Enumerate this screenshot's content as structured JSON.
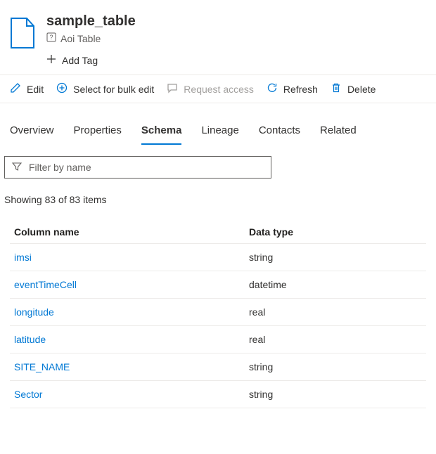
{
  "header": {
    "title": "sample_table",
    "subtitle": "Aoi Table",
    "add_tag_label": "Add Tag"
  },
  "toolbar": {
    "edit": "Edit",
    "bulk": "Select for bulk edit",
    "request": "Request access",
    "refresh": "Refresh",
    "delete": "Delete"
  },
  "tabs": {
    "overview": "Overview",
    "properties": "Properties",
    "schema": "Schema",
    "lineage": "Lineage",
    "contacts": "Contacts",
    "related": "Related"
  },
  "filter": {
    "placeholder": "Filter by name"
  },
  "count_text": "Showing 83 of 83 items",
  "columns": {
    "name": "Column name",
    "type": "Data type"
  },
  "rows": [
    {
      "name": "imsi",
      "type": "string"
    },
    {
      "name": "eventTimeCell",
      "type": "datetime"
    },
    {
      "name": "longitude",
      "type": "real"
    },
    {
      "name": "latitude",
      "type": "real"
    },
    {
      "name": "SITE_NAME",
      "type": "string"
    },
    {
      "name": "Sector",
      "type": "string"
    }
  ]
}
